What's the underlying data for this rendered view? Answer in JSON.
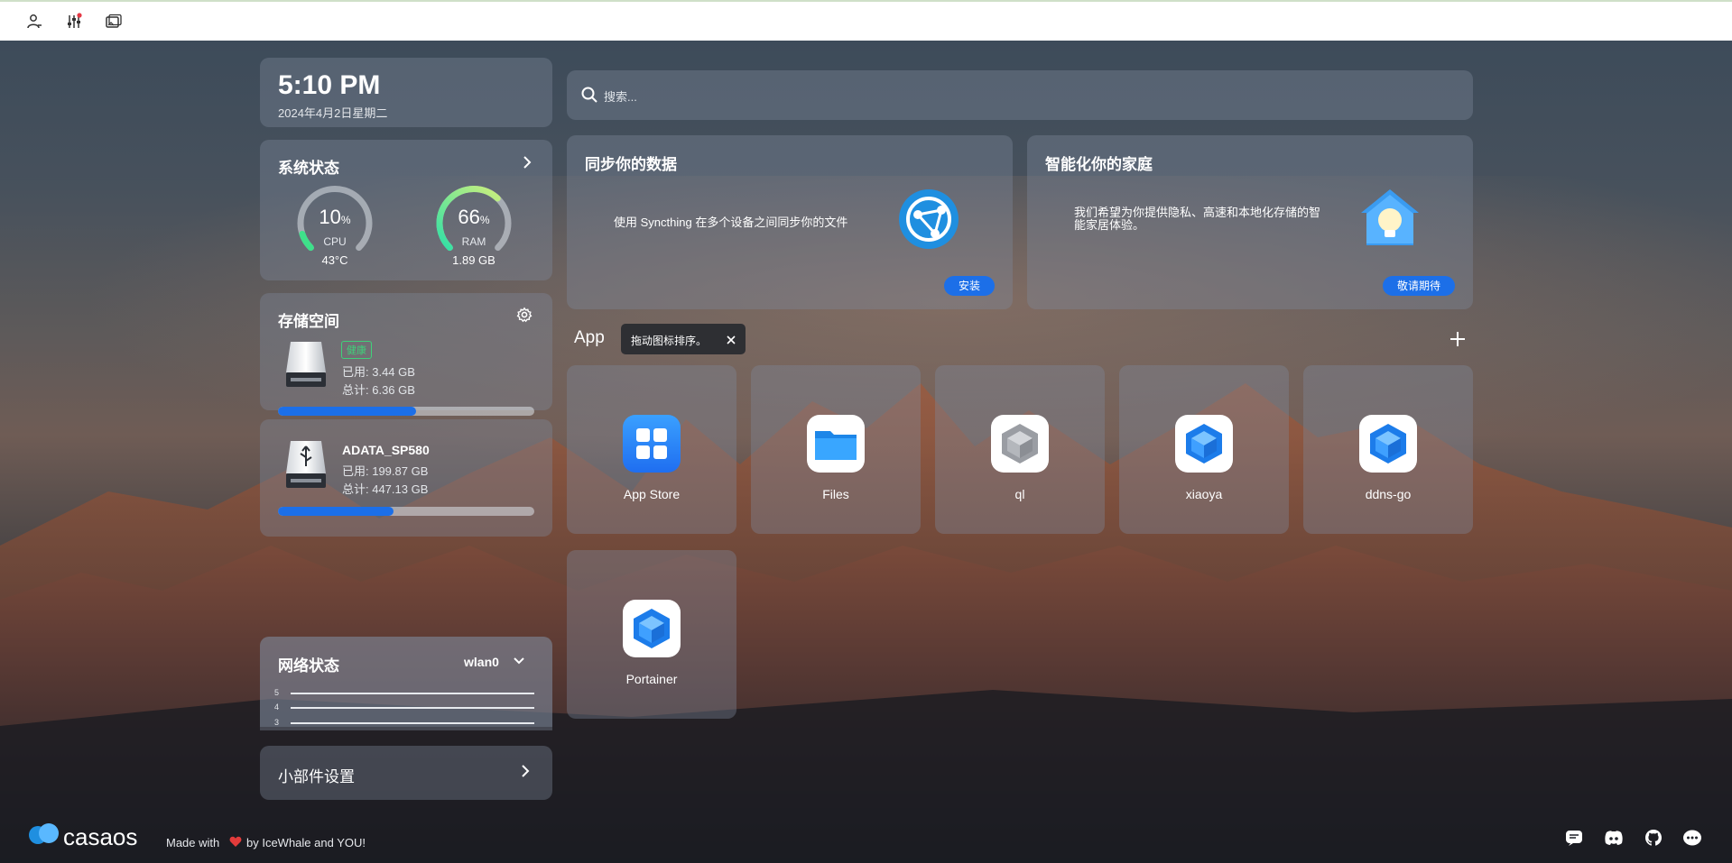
{
  "toolbar": {
    "icons": [
      "user-settings-icon",
      "sliders-icon",
      "images-icon"
    ]
  },
  "clock": {
    "time": "5:10 PM",
    "date": "2024年4月2日星期二"
  },
  "system": {
    "title": "系统状态",
    "cpu": {
      "value": "10",
      "unit": "%",
      "label": "CPU",
      "sub": "43°C",
      "percent": 10
    },
    "ram": {
      "value": "66",
      "unit": "%",
      "label": "RAM",
      "sub": "1.89 GB",
      "percent": 66
    }
  },
  "storage": {
    "title": "存储空间",
    "disks": [
      {
        "badge": "健康",
        "used": "已用: 3.44 GB",
        "total": "总计: 6.36 GB",
        "fraction": 0.54
      },
      {
        "name": "ADATA_SP580",
        "used": "已用: 199.87 GB",
        "total": "总计: 447.13 GB",
        "fraction": 0.45
      }
    ]
  },
  "network": {
    "title": "网络状态",
    "interface": "wlan0",
    "ticks": [
      "5",
      "4",
      "3"
    ]
  },
  "widgets": {
    "label": "小部件设置"
  },
  "search": {
    "placeholder": "搜索..."
  },
  "promo": {
    "sync": {
      "title": "同步你的数据",
      "desc": "使用 Syncthing 在多个设备之间同步你的文件",
      "button": "安装"
    },
    "home": {
      "title": "智能化你的家庭",
      "desc_line1": "我们希望为你提供隐私、高速和本地化存储的智",
      "desc_line2": "能家居体验。",
      "button": "敬请期待"
    }
  },
  "apps": {
    "header": "App",
    "tooltip": "拖动图标排序。",
    "items": [
      {
        "name": "App Store",
        "icon": "app-store-icon"
      },
      {
        "name": "Files",
        "icon": "folder-icon"
      },
      {
        "name": "ql",
        "icon": "cube-icon"
      },
      {
        "name": "xiaoya",
        "icon": "cube-icon"
      },
      {
        "name": "ddns-go",
        "icon": "cube-icon"
      },
      {
        "name": "Portainer",
        "icon": "cube-icon"
      }
    ]
  },
  "footer": {
    "logo": "casaos",
    "made_with": "Made with",
    "by": "by IceWhale and YOU!",
    "icons": [
      "feedback-icon",
      "discord-icon",
      "github-icon",
      "chat-icon"
    ]
  },
  "colors": {
    "accent": "#1c6fe8",
    "ram_gauge": "#38e0a0",
    "cpu_gauge": "#3ee08a",
    "healthy": "#3fd17a"
  }
}
